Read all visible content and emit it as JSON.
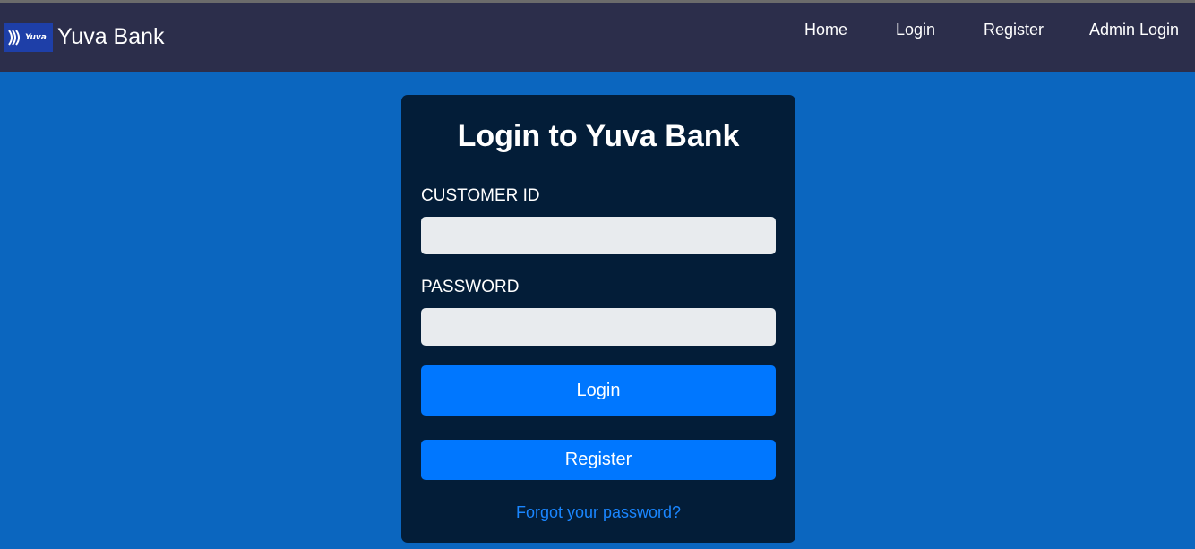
{
  "navbar": {
    "logo_text": "Yuva",
    "brand_name": "Yuva Bank",
    "links": [
      {
        "label": "Home"
      },
      {
        "label": "Login"
      },
      {
        "label": "Register"
      },
      {
        "label": "Admin Login"
      }
    ]
  },
  "login_card": {
    "title": "Login to Yuva Bank",
    "customer_id": {
      "label": "CUSTOMER ID",
      "value": "",
      "placeholder": ""
    },
    "password": {
      "label": "PASSWORD",
      "value": "",
      "placeholder": ""
    },
    "login_button": "Login",
    "register_button": "Register",
    "forgot_link": "Forgot your password?"
  },
  "colors": {
    "page_background": "#0b66bf",
    "navbar_background": "#2c2e4b",
    "card_background": "#031d38",
    "button_primary": "#0077ff",
    "link": "#1a86ff",
    "input_background": "#e8ebee"
  },
  "icons": {
    "logo": "yuva-logo-icon"
  }
}
